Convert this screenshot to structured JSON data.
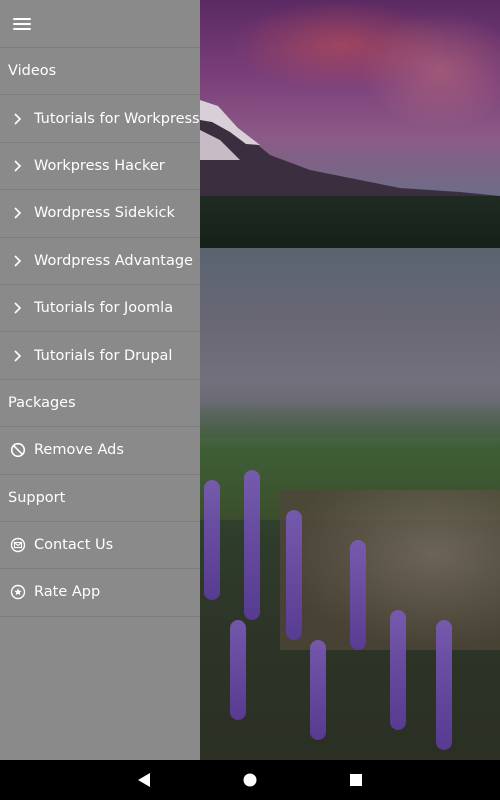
{
  "drawer": {
    "menu_icon": "hamburger-menu-icon",
    "items": [
      {
        "type": "section",
        "label": "Videos"
      },
      {
        "type": "item",
        "icon": "chevron-right-icon",
        "label": "Tutorials for Workpress"
      },
      {
        "type": "item",
        "icon": "chevron-right-icon",
        "label": "Workpress Hacker"
      },
      {
        "type": "item",
        "icon": "chevron-right-icon",
        "label": "Wordpress Sidekick"
      },
      {
        "type": "item",
        "icon": "chevron-right-icon",
        "label": "Wordpress Advantage"
      },
      {
        "type": "item",
        "icon": "chevron-right-icon",
        "label": "Tutorials for Joomla"
      },
      {
        "type": "item",
        "icon": "chevron-right-icon",
        "label": "Tutorials for Drupal"
      },
      {
        "type": "section",
        "label": "Packages"
      },
      {
        "type": "item",
        "icon": "block-icon",
        "label": "Remove Ads"
      },
      {
        "type": "section",
        "label": "Support"
      },
      {
        "type": "item",
        "icon": "mail-icon",
        "label": "Contact Us"
      },
      {
        "type": "item",
        "icon": "star-icon",
        "label": "Rate App"
      }
    ]
  },
  "navbar": {
    "back_icon": "back-triangle-icon",
    "home_icon": "home-circle-icon",
    "recents_icon": "recents-square-icon"
  },
  "colors": {
    "drawer_bg": "#8a8a8a",
    "text": "#ffffff",
    "navbar_bg": "#000000"
  }
}
